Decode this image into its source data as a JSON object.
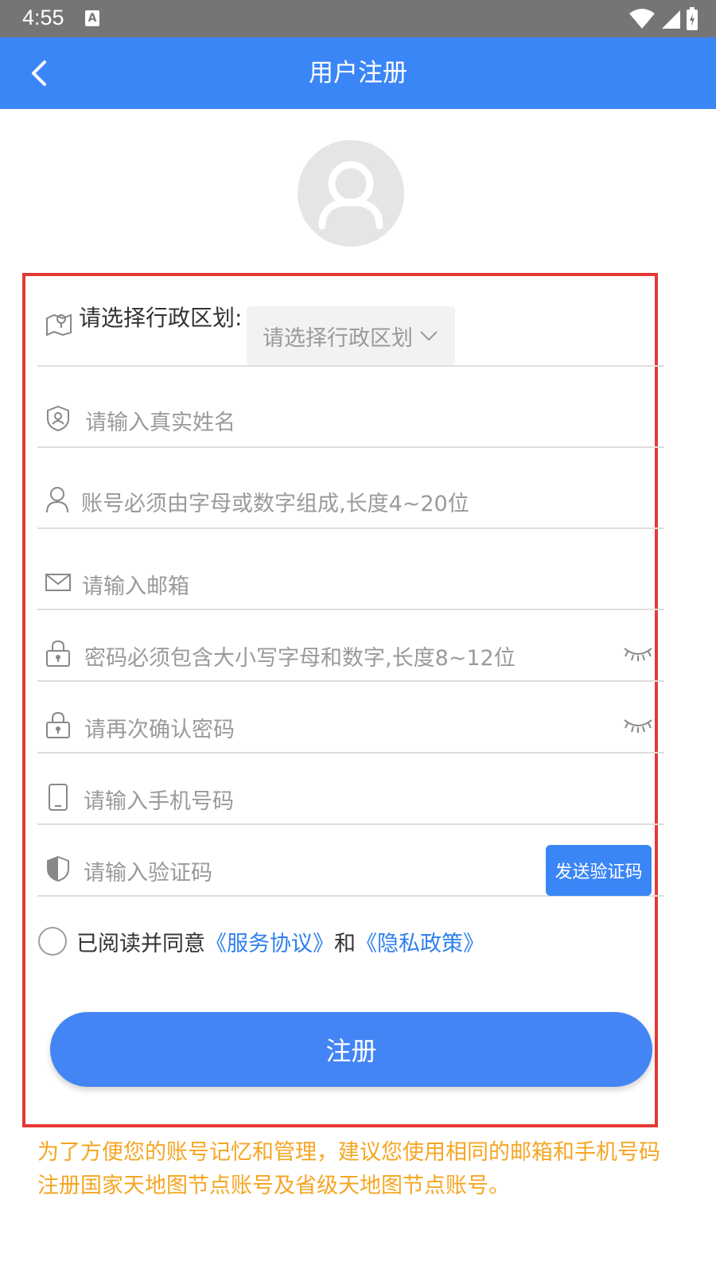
{
  "status_bar": {
    "time": "4:55",
    "notification_letter": "A"
  },
  "header": {
    "title": "用户注册",
    "back_icon": "chevron-left-icon"
  },
  "avatar": {
    "icon": "user-icon"
  },
  "form": {
    "region": {
      "label": "请选择行政区划:",
      "select_value": "请选择行政区划",
      "icon": "map-pin-icon"
    },
    "real_name": {
      "placeholder": "请输入真实姓名",
      "icon": "shield-user-icon"
    },
    "account": {
      "placeholder": "账号必须由字母或数字组成,长度4~20位",
      "icon": "user-icon"
    },
    "email": {
      "placeholder": "请输入邮箱",
      "icon": "mail-icon"
    },
    "password": {
      "placeholder": "密码必须包含大小写字母和数字,长度8~12位",
      "icon": "lock-icon"
    },
    "confirm_password": {
      "placeholder": "请再次确认密码",
      "icon": "lock-icon"
    },
    "phone": {
      "placeholder": "请输入手机号码",
      "icon": "phone-icon"
    },
    "code": {
      "placeholder": "请输入验证码",
      "send_label": "发送验证码",
      "icon": "shield-icon"
    }
  },
  "agreement": {
    "prefix": "已阅读并同意",
    "service": "《服务协议》",
    "and": "和",
    "privacy": "《隐私政策》"
  },
  "register_label": "注册",
  "tip": "为了方便您的账号记忆和管理，建议您使用相同的邮箱和手机号码注册国家天地图节点账号及省级天地图节点账号。",
  "colors": {
    "primary": "#3b86f7",
    "highlight_border": "#e53935",
    "tip": "#f5a623",
    "status_bar": "#757575"
  }
}
